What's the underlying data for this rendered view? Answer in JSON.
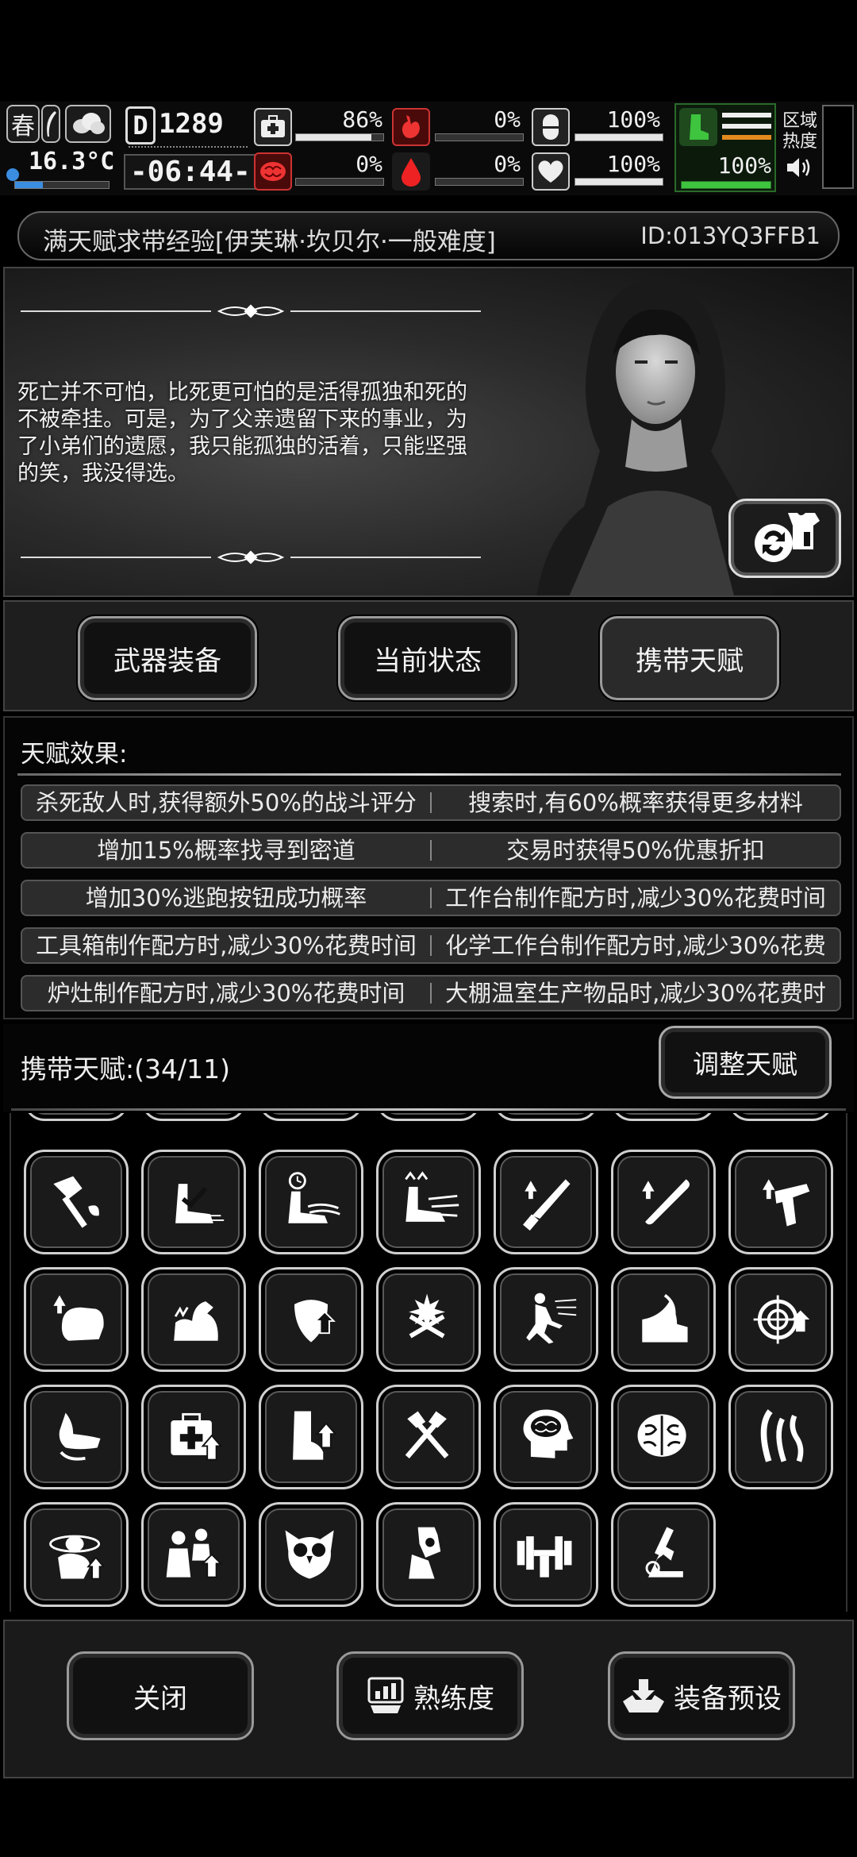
{
  "status": {
    "season": "春",
    "temperature": "16.3°C",
    "day": "1289",
    "clock": "-06:44-",
    "stats": [
      {
        "name": "health",
        "value": "86%",
        "fill": 0.86
      },
      {
        "name": "hunger",
        "value": "0%",
        "fill": 0
      },
      {
        "name": "medicine",
        "value": "100%",
        "fill": 1.0
      },
      {
        "name": "brain",
        "value": "0%",
        "fill": 0
      },
      {
        "name": "blood",
        "value": "0%",
        "fill": 0
      },
      {
        "name": "heart",
        "value": "100%",
        "fill": 1.0
      },
      {
        "name": "stamina",
        "value": "100%",
        "fill": 1.0
      }
    ],
    "area_label_1": "区域",
    "area_label_2": "热度"
  },
  "title": {
    "text": "满天赋求带经验[伊芙琳·坎贝尔·一般难度]",
    "id": "ID:013YQ3FFB1"
  },
  "story": {
    "quote": "死亡并不可怕，比死更可怕的是活得孤独和死的不被牵挂。可是，为了父亲遗留下来的事业，为了小弟们的遗愿，我只能孤独的活着，只能坚强的笑，我没得选。"
  },
  "tabs": [
    {
      "label": "武器装备"
    },
    {
      "label": "当前状态"
    },
    {
      "label": "携带天赋"
    }
  ],
  "effects": {
    "title": "天赋效果:",
    "rows": [
      [
        "杀死敌人时,获得额外50%的战斗评分",
        "搜索时,有60%概率获得更多材料"
      ],
      [
        "增加15%概率找寻到密道",
        "交易时获得50%优惠折扣"
      ],
      [
        "增加30%逃跑按钮成功概率",
        "工作台制作配方时,减少30%花费时间"
      ],
      [
        "工具箱制作配方时,减少30%花费时间",
        "化学工作台制作配方时,减少30%花费"
      ],
      [
        "炉灶制作配方时,减少30%花费时间",
        "大棚温室生产物品时,减少30%花费时"
      ]
    ]
  },
  "carry": {
    "label": "携带天赋:(34/11)",
    "adjust_label": "调整天赋"
  },
  "talents": [
    "axe-leaf-icon",
    "boot-speed-icon",
    "boot-clock-icon",
    "boot-dash-icon",
    "machete-up-icon",
    "bat-up-icon",
    "pistol-up-icon",
    "glove-up-icon",
    "muscle-icon",
    "shield-up-icon",
    "crossed-blades-icon",
    "running-man-icon",
    "shoe-ramp-icon",
    "target-up-icon",
    "arm-icon",
    "medkit-up-icon",
    "leg-up-icon",
    "crossed-axes-icon",
    "head-brain-icon",
    "brain-icon",
    "ribs-icon",
    "head-orbit-icon",
    "people-up-icon",
    "owl-icon",
    "camera-hand-icon",
    "dumbbell-icon",
    "microscope-icon"
  ],
  "bottom": {
    "close": "关闭",
    "proficiency": "熟练度",
    "preset": "装备预设"
  }
}
